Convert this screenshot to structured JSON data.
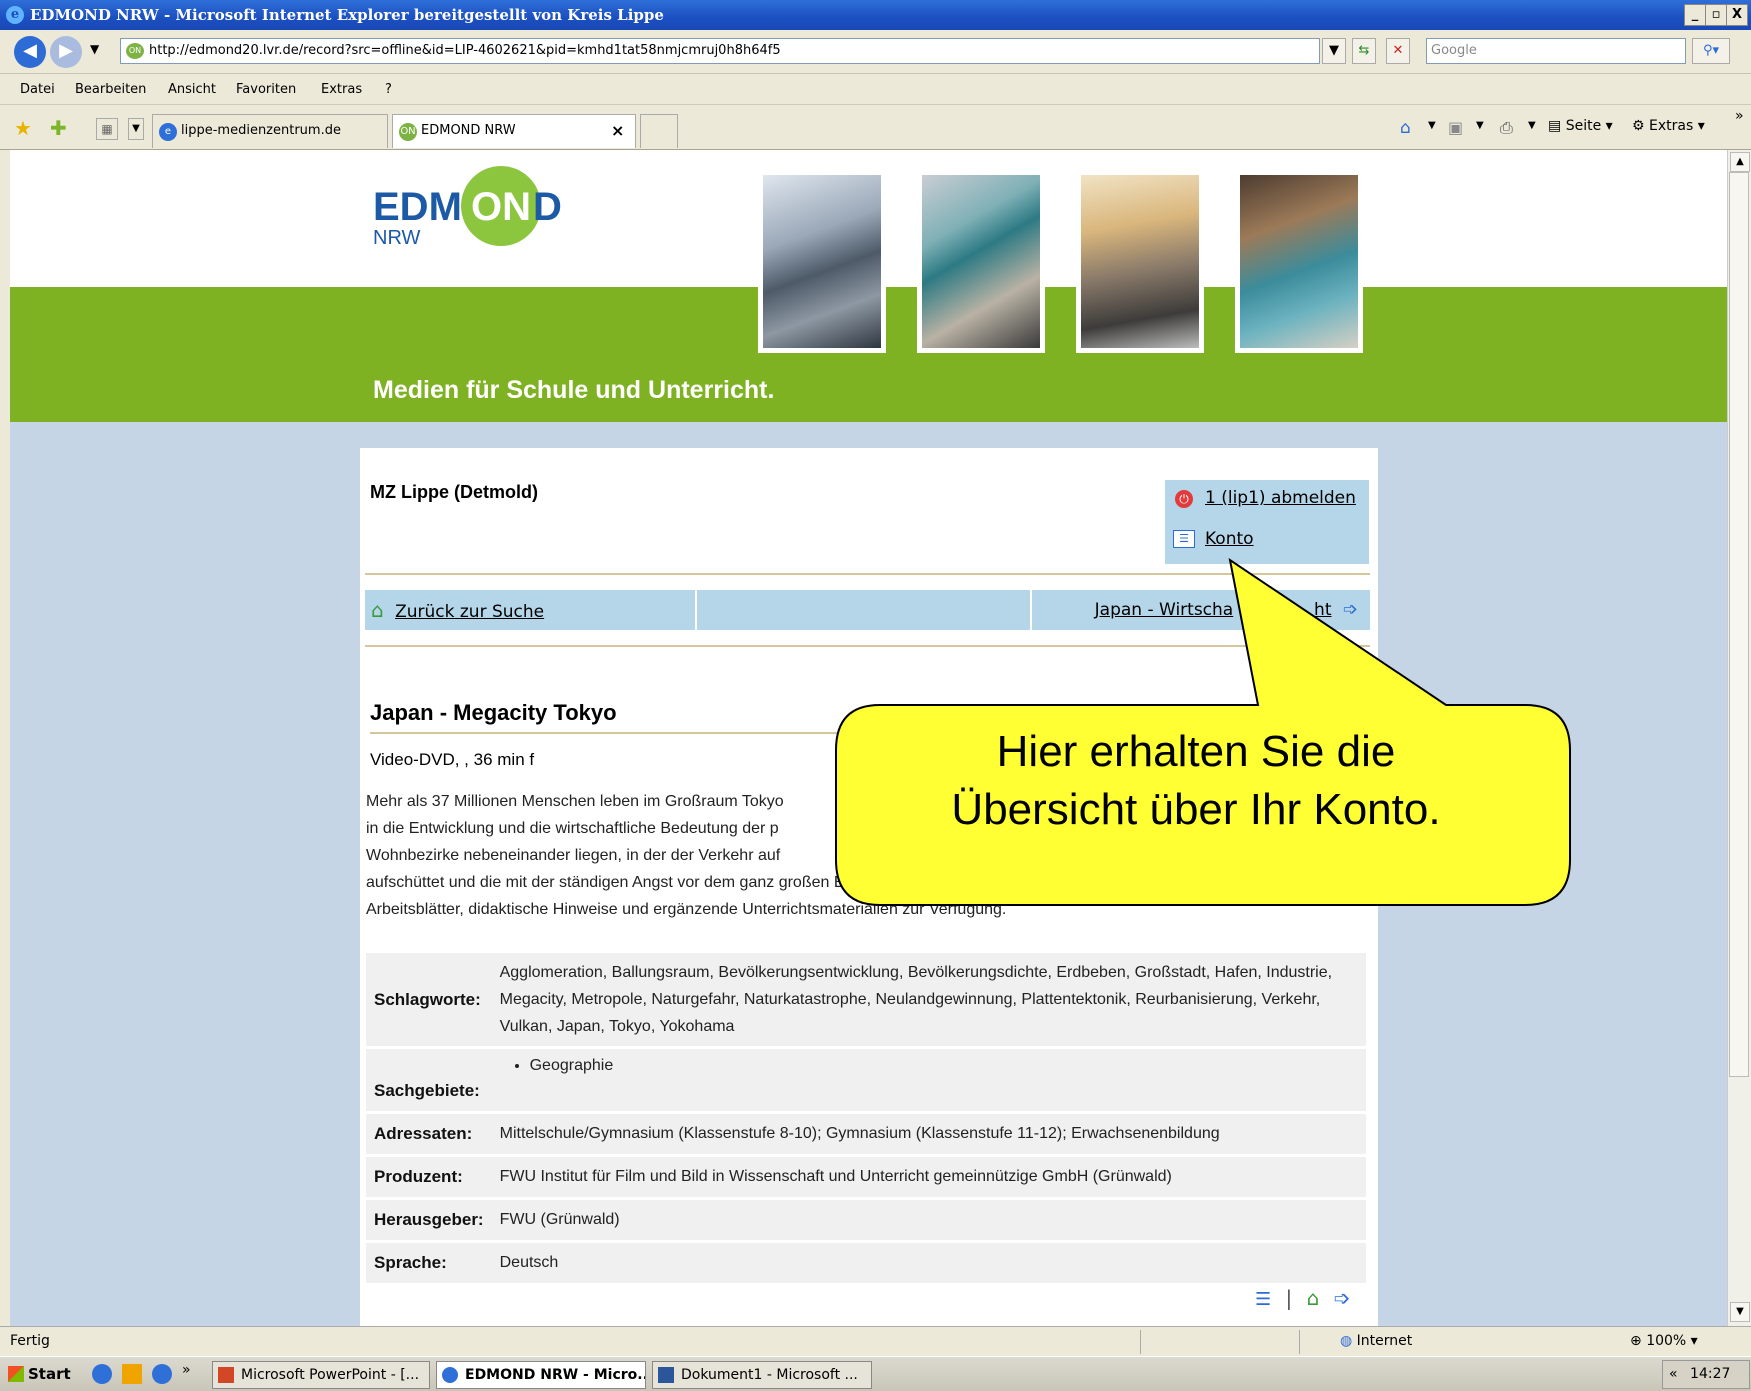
{
  "window": {
    "title": "EDMOND NRW - Microsoft Internet Explorer bereitgestellt von Kreis Lippe",
    "minimize": "_",
    "maximize": "▫",
    "close": "X"
  },
  "addressbar": {
    "url": "http://edmond20.lvr.de/record?src=offline&id=LIP-4602621&pid=kmhd1tat58nmjcmruj0h8h64f5",
    "search_placeholder": "Google"
  },
  "menu": {
    "items": [
      "Datei",
      "Bearbeiten",
      "Ansicht",
      "Favoriten",
      "Extras",
      "?"
    ]
  },
  "tabs": {
    "items": [
      "lippe-medienzentrum.de",
      "EDMOND NRW"
    ],
    "close": "×"
  },
  "toolbar_right": {
    "page": "Seite",
    "extras": "Extras",
    "more": "»"
  },
  "site": {
    "logo_main": "EDM",
    "logo_circle": "ON",
    "logo_end": "D",
    "logo_sub": "NRW",
    "tagline": "Medien für Schule und Unterricht."
  },
  "record": {
    "institution": "MZ Lippe (Detmold)",
    "logout_link": "1 (lip1) abmelden",
    "account_link": "Konto",
    "back_link": "Zurück zur Suche",
    "next_link": "Japan - Wirtscha",
    "next_link_tail": "ht",
    "title": "Japan - Megacity Tokyo",
    "media": "Video-DVD,   , 36 min f",
    "description_lines": [
      "Mehr als 37 Millionen Menschen leben im Großraum Tokyo",
      "in die Entwicklung und die wirtschaftliche Bedeutung der p",
      "Wohnbezirke nebeneinander liegen, in der der Verkehr auf",
      "aufschüttet und die mit der ständigen Angst vor dem ganz großen E",
      "Arbeitsblätter, didaktische Hinweise und ergänzende Unterrichtsmaterialien zur Verfügung."
    ],
    "details": {
      "keywords_label": "Schlagworte:",
      "keywords": "Agglomeration, Ballungsraum, Bevölkerungsentwicklung, Bevölkerungsdichte, Erdbeben, Großstadt, Hafen, Industrie, Megacity, Metropole, Naturgefahr, Naturkatastrophe, Neulandgewinnung, Plattentektonik, Reurbanisierung, Verkehr, Vulkan, Japan, Tokyo, Yokohama",
      "subjects_label": "Sachgebiete:",
      "subject": "Geographie",
      "audience_label": "Adressaten:",
      "audience": "Mittelschule/Gymnasium (Klassenstufe 8-10); Gymnasium (Klassenstufe 11-12); Erwachsenenbildung",
      "producer_label": "Produzent:",
      "producer": "FWU Institut für Film und Bild in Wissenschaft und Unterricht gemeinnützige GmbH (Grünwald)",
      "publisher_label": "Herausgeber:",
      "publisher": "FWU (Grünwald)",
      "language_label": "Sprache:",
      "language": "Deutsch"
    },
    "footer_sep": "|"
  },
  "callout": {
    "line1": "Hier erhalten Sie die",
    "line2": "Übersicht über Ihr Konto."
  },
  "statusbar": {
    "status": "Fertig",
    "zone": "Internet",
    "zoom": "100%"
  },
  "taskbar": {
    "start": "Start",
    "more": "»",
    "items": [
      "Microsoft PowerPoint - [...",
      "EDMOND NRW - Micro...",
      "Dokument1 - Microsoft ..."
    ],
    "clock": "14:27",
    "tray_arrow": "«"
  },
  "colors": {
    "green_band": "#7fb222",
    "page_bg": "#c5d5e6",
    "nav_blue": "#b5d5e8",
    "callout_yellow": "#ffff33",
    "logo_blue": "#1c5aa6"
  }
}
